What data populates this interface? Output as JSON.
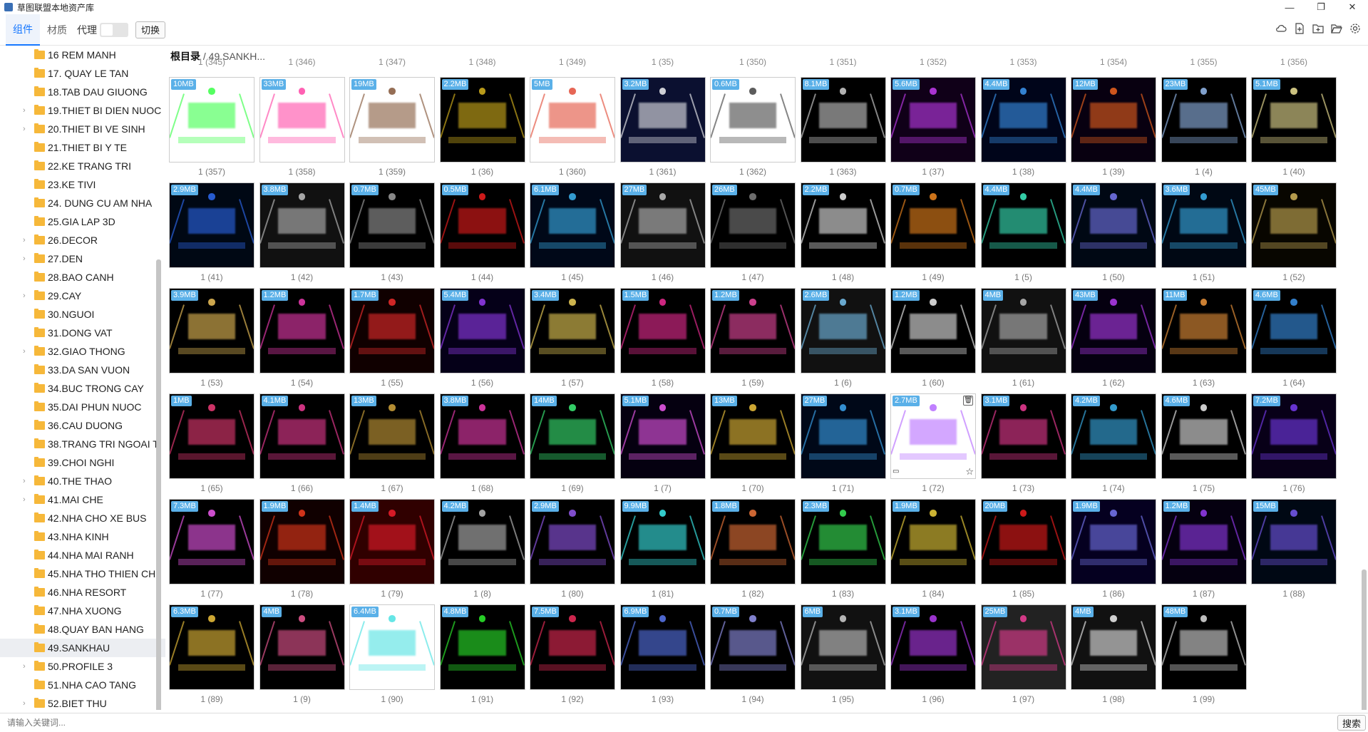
{
  "app": {
    "title": "草图联盟本地资产库",
    "window_buttons": [
      "—",
      "❐",
      "✕"
    ]
  },
  "toolbar": {
    "tabs": [
      {
        "label": "组件",
        "active": true
      },
      {
        "label": "材质",
        "active": false
      }
    ],
    "proxy_label": "代理",
    "proxy_on": false,
    "switch_label": "切换",
    "accent_color": "#1677ff",
    "right_icons": [
      "cloud-icon",
      "new-file-icon",
      "add-folder-icon",
      "open-folder-icon",
      "settings-icon"
    ]
  },
  "sidebar": {
    "items": [
      {
        "label": "16 REM MANH",
        "expandable": false
      },
      {
        "label": "17. QUAY LE TAN",
        "expandable": false
      },
      {
        "label": "18.TAB DAU GIUONG",
        "expandable": false
      },
      {
        "label": "19.THIET BI DIEN NUOC",
        "expandable": true
      },
      {
        "label": "20.THIET BI VE SINH",
        "expandable": true
      },
      {
        "label": "21.THIET BI Y TE",
        "expandable": false
      },
      {
        "label": "22.KE TRANG TRI",
        "expandable": false
      },
      {
        "label": "23.KE TIVI",
        "expandable": false
      },
      {
        "label": "24. DUNG CU AM NHA",
        "expandable": false
      },
      {
        "label": "25.GIA LAP 3D",
        "expandable": false
      },
      {
        "label": "26.DECOR",
        "expandable": true
      },
      {
        "label": "27.DEN",
        "expandable": true
      },
      {
        "label": "28.BAO CANH",
        "expandable": false
      },
      {
        "label": "29.CAY",
        "expandable": true
      },
      {
        "label": "30.NGUOI",
        "expandable": false
      },
      {
        "label": "31.DONG VAT",
        "expandable": false
      },
      {
        "label": "32.GIAO THONG",
        "expandable": true
      },
      {
        "label": "33.DA SAN VUON",
        "expandable": false
      },
      {
        "label": "34.BUC TRONG CAY",
        "expandable": false
      },
      {
        "label": "35.DAI PHUN NUOC",
        "expandable": false
      },
      {
        "label": "36.CAU DUONG",
        "expandable": false
      },
      {
        "label": "38.TRANG TRI NGOAI T",
        "expandable": false
      },
      {
        "label": "39.CHOI NGHI",
        "expandable": false
      },
      {
        "label": "40.THE THAO",
        "expandable": true
      },
      {
        "label": "41.MAI CHE",
        "expandable": true
      },
      {
        "label": "42.NHA CHO XE BUS",
        "expandable": false
      },
      {
        "label": "43.NHA KINH",
        "expandable": false
      },
      {
        "label": "44.NHA MAI RANH",
        "expandable": false
      },
      {
        "label": "45.NHA THO THIEN CH",
        "expandable": false
      },
      {
        "label": "46.NHA RESORT",
        "expandable": false
      },
      {
        "label": "47.NHA XUONG",
        "expandable": false
      },
      {
        "label": "48.QUAY BAN HANG",
        "expandable": false
      },
      {
        "label": "49.SANKHAU",
        "expandable": false,
        "selected": true
      },
      {
        "label": "50.PROFILE 3",
        "expandable": true
      },
      {
        "label": "51.NHA CAO TANG",
        "expandable": false
      },
      {
        "label": "52.BIET THU",
        "expandable": true
      }
    ]
  },
  "breadcrumb": {
    "root": "根目录",
    "separator": " / ",
    "current": "49.SANKH..."
  },
  "ghost_labels": [
    "1 (345)",
    "1 (346)",
    "1 (347)",
    "1 (348)",
    "1 (349)",
    "1 (35)",
    "1 (350)",
    "1 (351)",
    "1 (352)",
    "1 (353)",
    "1 (354)",
    "1 (355)",
    "1 (356)"
  ],
  "assets": [
    {
      "size": "10MB",
      "label": "1 (357)",
      "bg": "#fff",
      "accent": "#2aff3a"
    },
    {
      "size": "33MB",
      "label": "1 (358)",
      "bg": "#fff",
      "accent": "#ff3aa0"
    },
    {
      "size": "19MB",
      "label": "1 (359)",
      "bg": "#fff",
      "accent": "#7a4a2a"
    },
    {
      "size": "2.2MB",
      "label": "1 (36)",
      "bg": "#000",
      "accent": "#e6c020"
    },
    {
      "size": "5MB",
      "label": "1 (360)",
      "bg": "#fff",
      "accent": "#e0402a"
    },
    {
      "size": "3.2MB",
      "label": "1 (361)",
      "bg": "#0b1030",
      "accent": "#ffffff"
    },
    {
      "size": "0.6MB",
      "label": "1 (362)",
      "bg": "#fff",
      "accent": "#333333"
    },
    {
      "size": "8.1MB",
      "label": "1 (363)",
      "bg": "#000",
      "accent": "#dddddd"
    },
    {
      "size": "5.6MB",
      "label": "1 (37)",
      "bg": "#100018",
      "accent": "#d040ff"
    },
    {
      "size": "4.4MB",
      "label": "1 (38)",
      "bg": "#00051a",
      "accent": "#40a0ff"
    },
    {
      "size": "12MB",
      "label": "1 (39)",
      "bg": "#080010",
      "accent": "#ff6a20"
    },
    {
      "size": "23MB",
      "label": "1 (4)",
      "bg": "#000",
      "accent": "#a0c8ff"
    },
    {
      "size": "5.1MB",
      "label": "1 (40)",
      "bg": "#000",
      "accent": "#fff2a0"
    },
    {
      "size": "2.9MB",
      "label": "1 (41)",
      "bg": "#000814",
      "accent": "#3070ff"
    },
    {
      "size": "3.8MB",
      "label": "1 (42)",
      "bg": "#111",
      "accent": "#cccccc"
    },
    {
      "size": "0.7MB",
      "label": "1 (43)",
      "bg": "#000",
      "accent": "#aaaaaa"
    },
    {
      "size": "0.5MB",
      "label": "1 (44)",
      "bg": "#000",
      "accent": "#ff2020"
    },
    {
      "size": "6.1MB",
      "label": "1 (45)",
      "bg": "#000818",
      "accent": "#40c0ff"
    },
    {
      "size": "27MB",
      "label": "1 (46)",
      "bg": "#111",
      "accent": "#d0d0d0"
    },
    {
      "size": "26MB",
      "label": "1 (47)",
      "bg": "#000",
      "accent": "#888888"
    },
    {
      "size": "2.2MB",
      "label": "1 (48)",
      "bg": "#000",
      "accent": "#ffffff"
    },
    {
      "size": "0.7MB",
      "label": "1 (49)",
      "bg": "#000",
      "accent": "#ff9020"
    },
    {
      "size": "4.4MB",
      "label": "1 (5)",
      "bg": "#000",
      "accent": "#40ffd0"
    },
    {
      "size": "4.4MB",
      "label": "1 (50)",
      "bg": "#000814",
      "accent": "#8080ff"
    },
    {
      "size": "3.6MB",
      "label": "1 (51)",
      "bg": "#000814",
      "accent": "#40c0ff"
    },
    {
      "size": "45MB",
      "label": "1 (52)",
      "bg": "#080600",
      "accent": "#e0c060"
    },
    {
      "size": "3.9MB",
      "label": "1 (53)",
      "bg": "#000",
      "accent": "#ffd060"
    },
    {
      "size": "1.2MB",
      "label": "1 (54)",
      "bg": "#000",
      "accent": "#ff40c0"
    },
    {
      "size": "1.7MB",
      "label": "1 (55)",
      "bg": "#100000",
      "accent": "#ff3030"
    },
    {
      "size": "5.4MB",
      "label": "1 (56)",
      "bg": "#050018",
      "accent": "#a040ff"
    },
    {
      "size": "3.4MB",
      "label": "1 (57)",
      "bg": "#000",
      "accent": "#ffe060"
    },
    {
      "size": "1.5MB",
      "label": "1 (58)",
      "bg": "#000",
      "accent": "#ff30a0"
    },
    {
      "size": "1.2MB",
      "label": "1 (59)",
      "bg": "#000",
      "accent": "#ff50b0"
    },
    {
      "size": "2.6MB",
      "label": "1 (6)",
      "bg": "#111",
      "accent": "#80d0ff"
    },
    {
      "size": "1.2MB",
      "label": "1 (60)",
      "bg": "#000",
      "accent": "#ffffff"
    },
    {
      "size": "4MB",
      "label": "1 (61)",
      "bg": "#111",
      "accent": "#cccccc"
    },
    {
      "size": "43MB",
      "label": "1 (62)",
      "bg": "#050010",
      "accent": "#c040ff"
    },
    {
      "size": "11MB",
      "label": "1 (63)",
      "bg": "#000",
      "accent": "#ffa040"
    },
    {
      "size": "4.6MB",
      "label": "1 (64)",
      "bg": "#000",
      "accent": "#40a0ff"
    },
    {
      "size": "1MB",
      "label": "1 (65)",
      "bg": "#000",
      "accent": "#ff4080"
    },
    {
      "size": "4.1MB",
      "label": "1 (66)",
      "bg": "#000",
      "accent": "#ff40a0"
    },
    {
      "size": "13MB",
      "label": "1 (67)",
      "bg": "#000",
      "accent": "#e0b040"
    },
    {
      "size": "3.8MB",
      "label": "1 (68)",
      "bg": "#000",
      "accent": "#ff40c0"
    },
    {
      "size": "14MB",
      "label": "1 (69)",
      "bg": "#000",
      "accent": "#40ff80"
    },
    {
      "size": "5.1MB",
      "label": "1 (7)",
      "bg": "#050010",
      "accent": "#ff60ff"
    },
    {
      "size": "13MB",
      "label": "1 (70)",
      "bg": "#000",
      "accent": "#ffd040"
    },
    {
      "size": "27MB",
      "label": "1 (71)",
      "bg": "#000818",
      "accent": "#40b0ff"
    },
    {
      "size": "2.7MB",
      "label": "1 (72)",
      "bg": "#fff",
      "accent": "#b060ff"
    },
    {
      "size": "3.1MB",
      "label": "1 (73)",
      "bg": "#000",
      "accent": "#ff40a0"
    },
    {
      "size": "4.2MB",
      "label": "1 (74)",
      "bg": "#000",
      "accent": "#40c0ff"
    },
    {
      "size": "4.6MB",
      "label": "1 (75)",
      "bg": "#000",
      "accent": "#ffffff"
    },
    {
      "size": "7.2MB",
      "label": "1 (76)",
      "bg": "#080018",
      "accent": "#8040ff"
    },
    {
      "size": "7.3MB",
      "label": "1 (77)",
      "bg": "#000",
      "accent": "#ff60ff"
    },
    {
      "size": "1.9MB",
      "label": "1 (78)",
      "bg": "#100000",
      "accent": "#ff4020"
    },
    {
      "size": "1.4MB",
      "label": "1 (79)",
      "bg": "#300000",
      "accent": "#ff2030"
    },
    {
      "size": "4.2MB",
      "label": "1 (8)",
      "bg": "#000",
      "accent": "#cccccc"
    },
    {
      "size": "2.9MB",
      "label": "1 (80)",
      "bg": "#000",
      "accent": "#a060ff"
    },
    {
      "size": "9.9MB",
      "label": "1 (81)",
      "bg": "#000",
      "accent": "#40ffff"
    },
    {
      "size": "1.8MB",
      "label": "1 (82)",
      "bg": "#000",
      "accent": "#ff8040"
    },
    {
      "size": "2.3MB",
      "label": "1 (83)",
      "bg": "#000",
      "accent": "#40ff60"
    },
    {
      "size": "1.9MB",
      "label": "1 (84)",
      "bg": "#000",
      "accent": "#ffe040"
    },
    {
      "size": "20MB",
      "label": "1 (85)",
      "bg": "#000",
      "accent": "#ff2020"
    },
    {
      "size": "1.9MB",
      "label": "1 (86)",
      "bg": "#050020",
      "accent": "#8080ff"
    },
    {
      "size": "1.2MB",
      "label": "1 (87)",
      "bg": "#050010",
      "accent": "#a040ff"
    },
    {
      "size": "15MB",
      "label": "1 (88)",
      "bg": "#000814",
      "accent": "#8060ff"
    },
    {
      "size": "6.3MB",
      "label": "1 (89)",
      "bg": "#000",
      "accent": "#ffd040"
    },
    {
      "size": "4MB",
      "label": "1 (9)",
      "bg": "#000",
      "accent": "#ff60a0"
    },
    {
      "size": "6.4MB",
      "label": "1 (90)",
      "bg": "#fff",
      "accent": "#40e0e0"
    },
    {
      "size": "4.8MB",
      "label": "1 (91)",
      "bg": "#000",
      "accent": "#30ff30"
    },
    {
      "size": "7.5MB",
      "label": "1 (92)",
      "bg": "#000",
      "accent": "#ff3060"
    },
    {
      "size": "6.9MB",
      "label": "1 (93)",
      "bg": "#000",
      "accent": "#6080ff"
    },
    {
      "size": "0.7MB",
      "label": "1 (94)",
      "bg": "#000",
      "accent": "#a0a0ff"
    },
    {
      "size": "6MB",
      "label": "1 (95)",
      "bg": "#111",
      "accent": "#dddddd"
    },
    {
      "size": "3.1MB",
      "label": "1 (96)",
      "bg": "#000",
      "accent": "#c040ff"
    },
    {
      "size": "25MB",
      "label": "1 (97)",
      "bg": "#222",
      "accent": "#ff40a0"
    },
    {
      "size": "4MB",
      "label": "1 (98)",
      "bg": "#111",
      "accent": "#ffffff"
    },
    {
      "size": "48MB",
      "label": "1 (99)",
      "bg": "#000",
      "accent": "#eeeeee"
    }
  ],
  "hovered_asset": "1 (72)",
  "search": {
    "placeholder": "请输入关键词...",
    "button_label": "搜索"
  }
}
